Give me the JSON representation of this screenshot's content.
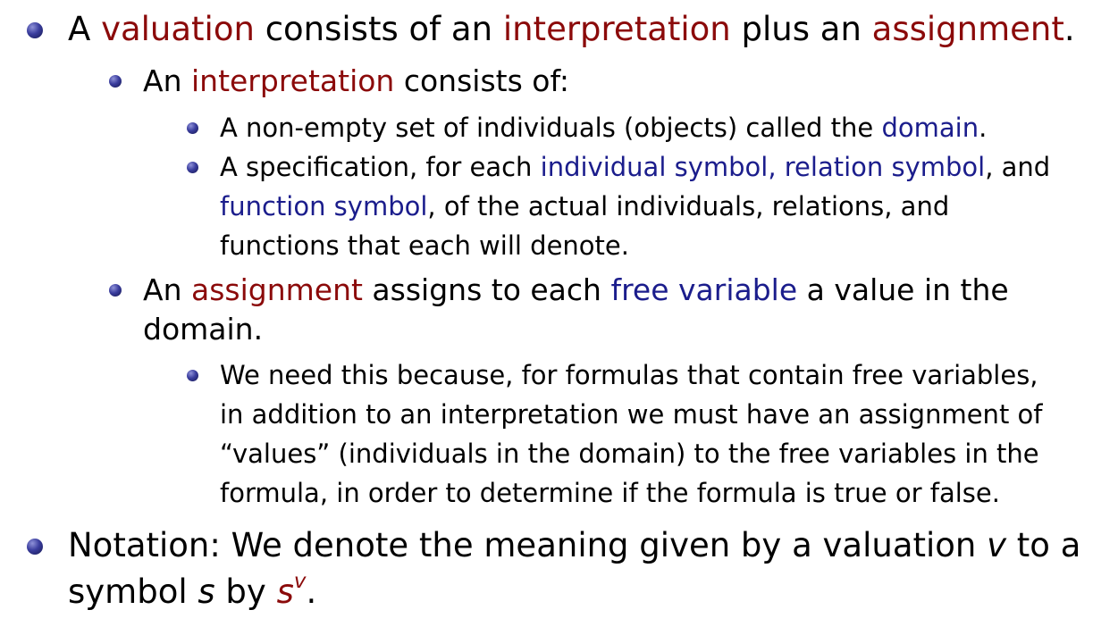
{
  "bullets": {
    "b1": {
      "t1": "A ",
      "valuation": "valuation",
      "t2": " consists of an ",
      "interpretation": "interpretation",
      "t3": " plus an ",
      "assignment": "assignment",
      "t4": "."
    },
    "b1_1": {
      "t1": "An ",
      "interpretation": "interpretation",
      "t2": " consists of:"
    },
    "b1_1_1": {
      "t1": "A non-empty set of individuals (objects) called the ",
      "domain": "domain",
      "t2": "."
    },
    "b1_1_2": {
      "t1": "A specification, for each ",
      "symbols": "individual symbol, relation symbol",
      "t2": ", and",
      "function_symbol": "function symbol",
      "t3": ", of the actual individuals, relations, and",
      "line3": "functions that each will denote."
    },
    "b1_2": {
      "t1": "An ",
      "assignment": "assignment",
      "t2": " assigns to each ",
      "free_variable": "free variable",
      "t3": " a value in the",
      "line2": "domain."
    },
    "b1_2_1": {
      "line1": "We need this because, for formulas that contain free variables,",
      "line2": "in addition to an interpretation we must have an assignment of",
      "line3": "“values” (individuals in the domain) to the free variables in the",
      "line4": "formula, in order to determine if the formula is true or false."
    },
    "b2": {
      "t1": "Notation: We denote the meaning given by a valuation ",
      "v": "v",
      "t2": " to a",
      "t3": "symbol ",
      "s": "s",
      "t4": " by ",
      "sv_base": "s",
      "sv_sup": "v",
      "t5": "."
    }
  },
  "colors": {
    "defined_term": "#8b0a0a",
    "highlight_term": "#1b1d8c",
    "bullet": "#2e3192"
  }
}
